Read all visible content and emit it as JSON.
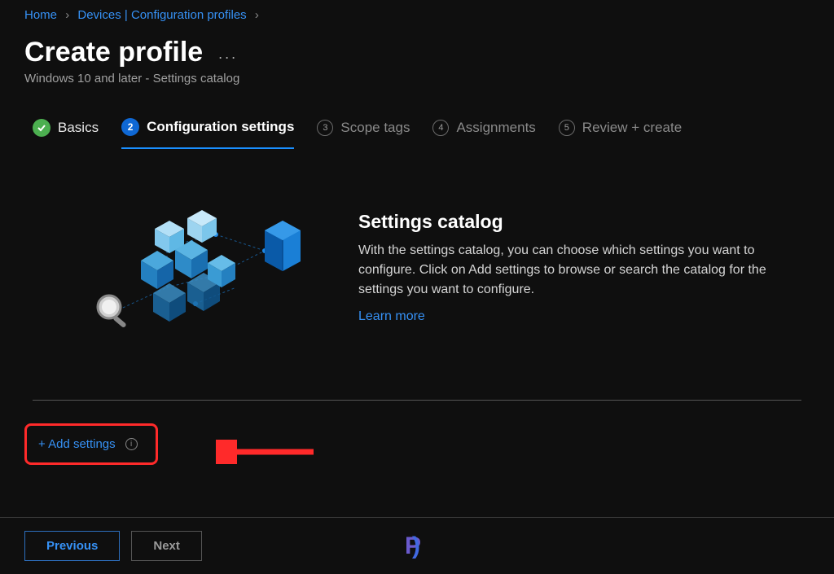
{
  "breadcrumb": {
    "home": "Home",
    "devices": "Devices | Configuration profiles"
  },
  "header": {
    "title": "Create profile",
    "subtitle": "Windows 10 and later - Settings catalog"
  },
  "tabs": {
    "basics": {
      "label": "Basics"
    },
    "config": {
      "num": "2",
      "label": "Configuration settings"
    },
    "scope": {
      "num": "3",
      "label": "Scope tags"
    },
    "assign": {
      "num": "4",
      "label": "Assignments"
    },
    "review": {
      "num": "5",
      "label": "Review + create"
    }
  },
  "info": {
    "heading": "Settings catalog",
    "body": "With the settings catalog, you can choose which settings you want to configure. Click on Add settings to browse or search the catalog for the settings you want to configure.",
    "learn_more": "Learn more"
  },
  "add_settings": {
    "label": "+ Add settings"
  },
  "footer": {
    "previous": "Previous",
    "next": "Next"
  }
}
